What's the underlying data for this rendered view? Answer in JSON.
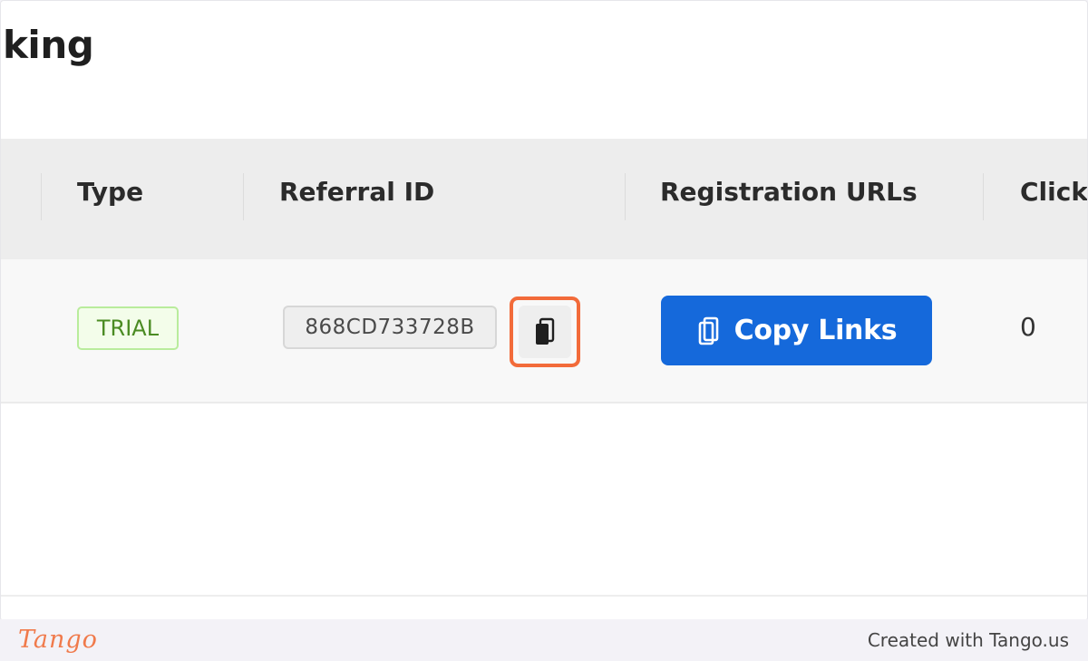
{
  "page": {
    "title": "king"
  },
  "table": {
    "headers": {
      "type": "Type",
      "referral_id": "Referral ID",
      "registration_urls": "Registration URLs",
      "clicks": "Click"
    },
    "row": {
      "type_badge": "TRIAL",
      "referral_id": "868CD733728B",
      "copy_links_label": "Copy Links",
      "clicks": "0"
    }
  },
  "footer": {
    "logo": "Tango",
    "created_with": "Created with Tango.us"
  },
  "colors": {
    "accent": "#1569db",
    "highlight": "#f26b3a",
    "badge_text": "#4b8b23",
    "badge_border": "#b9ec9c"
  },
  "icons": {
    "copy_id": "copy-icon",
    "copy_links": "copy-icon"
  }
}
